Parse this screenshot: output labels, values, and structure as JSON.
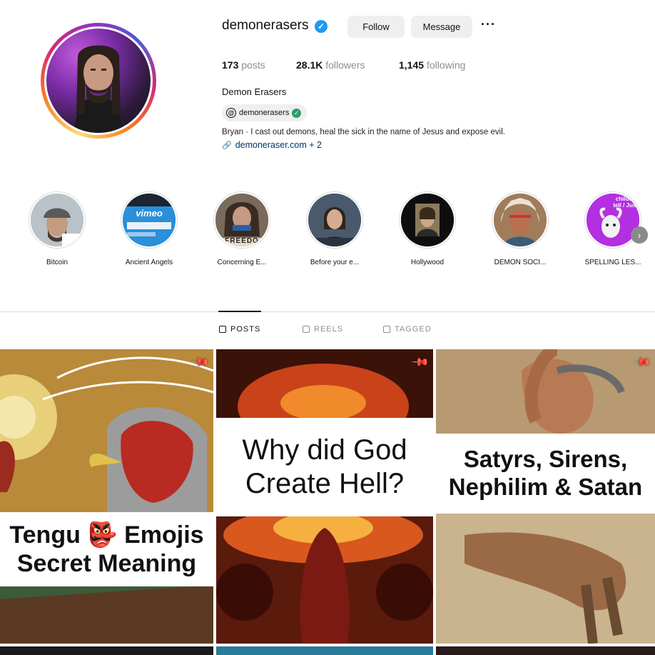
{
  "profile": {
    "username": "demonerasers",
    "follow_label": "Follow",
    "message_label": "Message",
    "more_label": "···",
    "stats": {
      "posts_count": "173",
      "posts_label": "posts",
      "followers_count": "28.1K",
      "followers_label": "followers",
      "following_count": "1,145",
      "following_label": "following"
    },
    "display_name": "Demon Erasers",
    "threads_handle": "demonerasers",
    "bio": "Bryan · I cast out demons, heal the sick in the name of Jesus and expose evil.",
    "link": "demoneraser.com + 2"
  },
  "highlights": [
    {
      "label": "Bitcoin",
      "icon": "portrait-cap"
    },
    {
      "label": "Ancient Angels",
      "icon": "vimeo-screen",
      "badge": "vimeo"
    },
    {
      "label": "Concerning E...",
      "icon": "portrait-freedom",
      "badge": "FREEDO"
    },
    {
      "label": "Before your e...",
      "icon": "portrait-woman"
    },
    {
      "label": "Hollywood",
      "icon": "portrait-frame"
    },
    {
      "label": "DEMON SOCI...",
      "icon": "portrait-headdress"
    },
    {
      "label": "SPELLING LES...",
      "icon": "goat-purple",
      "badge": "children tell / Just"
    }
  ],
  "tabs": [
    {
      "label": "POSTS",
      "icon": "grid-icon"
    },
    {
      "label": "REELS",
      "icon": "reels-icon"
    },
    {
      "label": "TAGGED",
      "icon": "tagged-icon"
    }
  ],
  "posts": [
    {
      "caption_line1": "Tengu 👺 Emojis",
      "caption_line2": "Secret Meaning",
      "pinned": true
    },
    {
      "caption_line1": "Why did God",
      "caption_line2": "Create Hell?",
      "pinned": true
    },
    {
      "caption_line1": "Satyrs, Sirens,",
      "caption_line2": "Nephilim & Satan",
      "pinned": true
    }
  ],
  "colors": {
    "accent_blue": "#1d9bf0",
    "link_blue": "#00376b",
    "muted_gray": "#8e8e8e",
    "button_gray": "#efefef"
  }
}
